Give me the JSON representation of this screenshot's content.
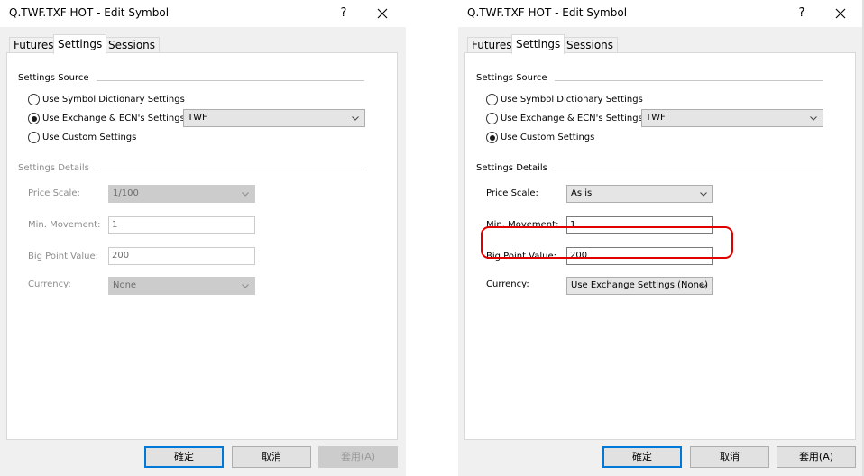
{
  "left": {
    "title": "Q.TWF.TXF HOT - Edit Symbol",
    "help": "?",
    "tabs": [
      {
        "label": "Futures"
      },
      {
        "label": "Settings"
      },
      {
        "label": "Sessions"
      }
    ],
    "settings_source": {
      "label": "Settings Source",
      "options": [
        {
          "label": "Use Symbol Dictionary Settings",
          "checked": false
        },
        {
          "label": "Use Exchange & ECN's Settings",
          "checked": true
        },
        {
          "label": "Use Custom Settings",
          "checked": false
        }
      ],
      "exchange_value": "TWF"
    },
    "settings_details": {
      "label": "Settings Details",
      "price_scale": {
        "label": "Price Scale:",
        "value": "1/100"
      },
      "min_movement": {
        "label": "Min. Movement:",
        "value": "1"
      },
      "big_point_value": {
        "label": "Big Point Value:",
        "value": "200"
      },
      "currency": {
        "label": "Currency:",
        "value": "None"
      }
    },
    "buttons": {
      "ok": "確定",
      "cancel": "取消",
      "apply": "套用(A)"
    }
  },
  "right": {
    "title": "Q.TWF.TXF HOT - Edit Symbol",
    "help": "?",
    "tabs": [
      {
        "label": "Futures"
      },
      {
        "label": "Settings"
      },
      {
        "label": "Sessions"
      }
    ],
    "settings_source": {
      "label": "Settings Source",
      "options": [
        {
          "label": "Use Symbol Dictionary Settings",
          "checked": false
        },
        {
          "label": "Use Exchange & ECN's Settings",
          "checked": false
        },
        {
          "label": "Use Custom Settings",
          "checked": true
        }
      ],
      "exchange_value": "TWF"
    },
    "settings_details": {
      "label": "Settings Details",
      "price_scale": {
        "label": "Price Scale:",
        "value": "As is"
      },
      "min_movement": {
        "label": "Min. Movement:",
        "value": "1"
      },
      "big_point_value": {
        "label": "Big Point Value:",
        "value": "200"
      },
      "currency": {
        "label": "Currency:",
        "value": "Use Exchange Settings (None)"
      }
    },
    "buttons": {
      "ok": "確定",
      "cancel": "取消",
      "apply": "套用(A)"
    }
  },
  "colors": {
    "highlight": "#e00000",
    "default_button_border": "#0078d7"
  },
  "icons": {
    "close": "close-icon",
    "dropdown": "chevron-down-icon"
  }
}
